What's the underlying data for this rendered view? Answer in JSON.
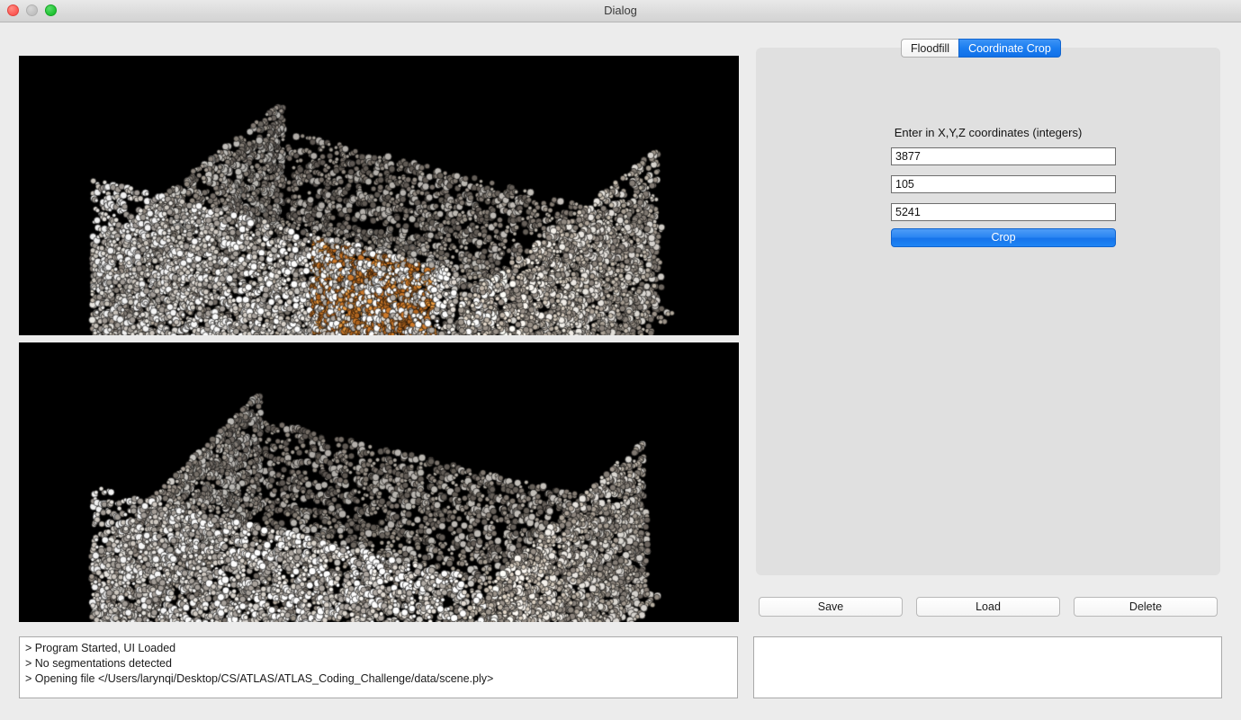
{
  "window": {
    "title": "Dialog",
    "controls": [
      {
        "name": "close",
        "label": "close-button"
      },
      {
        "name": "minimize",
        "label": "minimize-button"
      },
      {
        "name": "zoom",
        "label": "zoom-button"
      }
    ]
  },
  "viewports": {
    "top": {
      "name": "point-cloud-original",
      "background": "#000000",
      "description": "3D point cloud of a scanned room with an orange highlighted wall segment"
    },
    "bottom": {
      "name": "point-cloud-cropped",
      "background": "#000000",
      "description": "3D point cloud after coordinate crop, orange segment removed"
    }
  },
  "console": {
    "lines": [
      "> Program Started, UI Loaded",
      "> No segmentations detected",
      "> Opening file </Users/larynqi/Desktop/CS/ATLAS/ATLAS_Coding_Challenge/data/scene.ply>"
    ]
  },
  "tabs": [
    {
      "label": "Floodfill",
      "active": false
    },
    {
      "label": "Coordinate Crop",
      "active": true
    }
  ],
  "coordinate_crop": {
    "instructions": "Enter in X,Y,Z coordinates (integers)",
    "x": "3877",
    "y": "105",
    "z": "5241",
    "x_placeholder": "",
    "y_placeholder": "",
    "z_placeholder": "",
    "crop_label": "Crop"
  },
  "actions": {
    "save": "Save",
    "load": "Load",
    "delete": "Delete"
  },
  "output": {
    "value": ""
  },
  "colors": {
    "accent_blue": "#1b7df0",
    "panel_grey": "#e0e0e0",
    "window_grey": "#ececec",
    "viewport_black": "#000000",
    "highlight_orange": "#c8781f"
  }
}
